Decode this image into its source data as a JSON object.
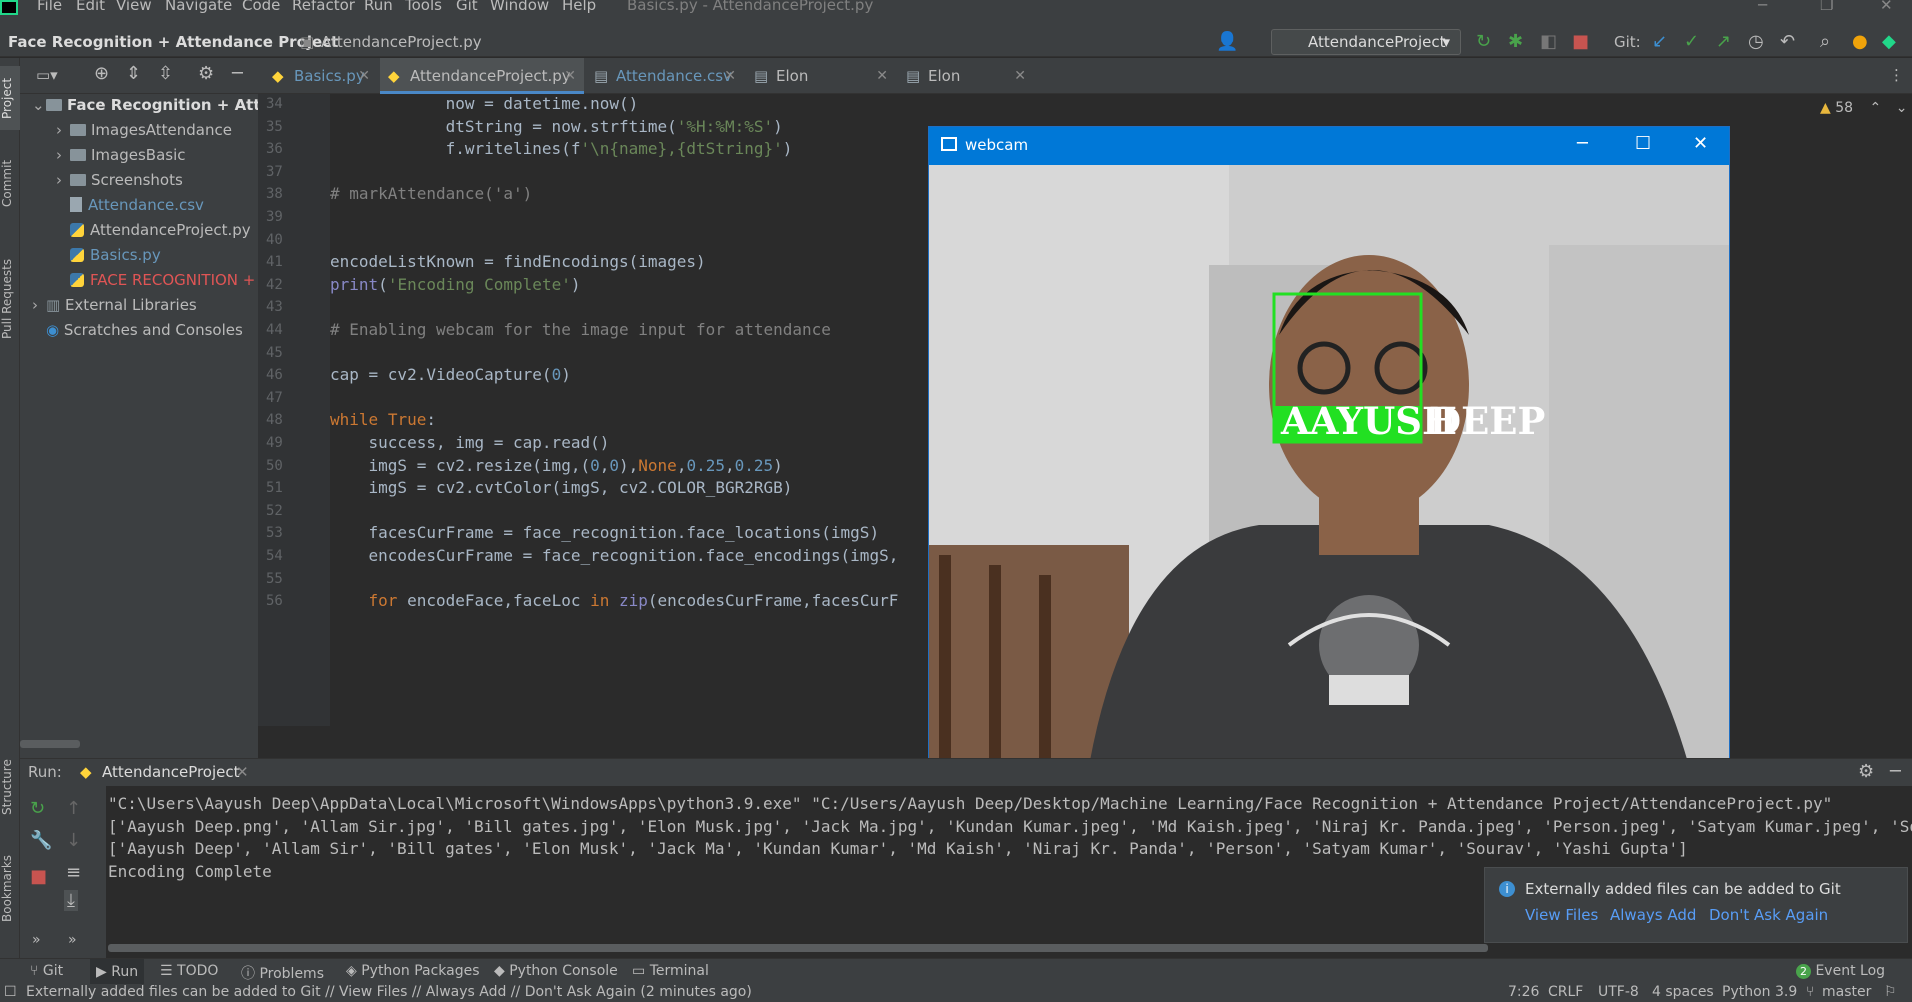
{
  "menubar": {
    "items": [
      "File",
      "Edit",
      "View",
      "Navigate",
      "Code",
      "Refactor",
      "Run",
      "Tools",
      "Git",
      "Window",
      "Help"
    ],
    "window_title": "Basics.py - AttendanceProject.py"
  },
  "navbar": {
    "project": "Face Recognition + Attendance Project",
    "file": "AttendanceProject.py",
    "run_config": "AttendanceProject",
    "git_label": "Git:"
  },
  "left_strip": {
    "project": "Project",
    "commit": "Commit",
    "pull_requests": "Pull Requests",
    "structure": "Structure",
    "bookmarks": "Bookmarks"
  },
  "project_tree": [
    {
      "label": "Face Recognition + Attenc",
      "kind": "folder",
      "level": 0,
      "expanded": true,
      "bold": true
    },
    {
      "label": "ImagesAttendance",
      "kind": "folder",
      "level": 1
    },
    {
      "label": "ImagesBasic",
      "kind": "folder",
      "level": 1
    },
    {
      "label": "Screenshots",
      "kind": "folder",
      "level": 1
    },
    {
      "label": "Attendance.csv",
      "kind": "csv",
      "level": 1,
      "color": "#6897bb"
    },
    {
      "label": "AttendanceProject.py",
      "kind": "py",
      "level": 1
    },
    {
      "label": "Basics.py",
      "kind": "py",
      "level": 1,
      "color": "#6897bb"
    },
    {
      "label": "FACE RECOGNITION + A",
      "kind": "py",
      "level": 1,
      "color": "#e05555"
    },
    {
      "label": "External Libraries",
      "kind": "lib",
      "level": 0
    },
    {
      "label": "Scratches and Consoles",
      "kind": "scratch",
      "level": 0
    }
  ],
  "editor_tabs": [
    {
      "label": "Basics.py",
      "color": "#6897bb",
      "active": false
    },
    {
      "label": "AttendanceProject.py",
      "color": "#bbbbbb",
      "active": true
    },
    {
      "label": "Attendance.csv",
      "color": "#6897bb",
      "active": false
    },
    {
      "label": "Elon Musk.jpg",
      "color": "#bbbbbb",
      "active": false
    },
    {
      "label": "Elon test.jpg",
      "color": "#bbbbbb",
      "active": false
    }
  ],
  "editor": {
    "warnings": "58",
    "line_numbers": [
      "34",
      "35",
      "36",
      "37",
      "38",
      "39",
      "40",
      "41",
      "42",
      "43",
      "44",
      "45",
      "46",
      "47",
      "48",
      "49",
      "50",
      "51",
      "52",
      "53",
      "54",
      "55",
      "56"
    ],
    "lines": [
      "            now = datetime.now()",
      "            dtString = now.strftime('%H:%M:%S')",
      "            f.writelines(f'\\n{name},{dtString}')",
      "",
      "# markAttendance('a')",
      "",
      "",
      "encodeListKnown = findEncodings(images)",
      "print('Encoding Complete')",
      "",
      "# Enabling webcam for the image input for attendance",
      "",
      "cap = cv2.VideoCapture(0)",
      "",
      "while True:",
      "    success, img = cap.read()",
      "    imgS = cv2.resize(img,(0,0),None,0.25,0.25)",
      "    imgS = cv2.cvtColor(imgS, cv2.COLOR_BGR2RGB)",
      "",
      "    facesCurFrame = face_recognition.face_locations(imgS)",
      "    encodesCurFrame = face_recognition.face_encodings(imgS,",
      "",
      "    for encodeFace,faceLoc in zip(encodesCurFrame,facesCurF"
    ]
  },
  "webcam": {
    "title": "webcam",
    "label_box": "AAYUSH",
    "label_rest": "DEEP"
  },
  "run": {
    "label": "Run:",
    "tab": "AttendanceProject",
    "console": [
      "\"C:\\Users\\Aayush Deep\\AppData\\Local\\Microsoft\\WindowsApps\\python3.9.exe\" \"C:/Users/Aayush Deep/Desktop/Machine Learning/Face Recognition + Attendance Project/AttendanceProject.py\"",
      "['Aayush Deep.png', 'Allam Sir.jpg', 'Bill gates.jpg', 'Elon Musk.jpg', 'Jack Ma.jpg', 'Kundan Kumar.jpeg', 'Md Kaish.jpeg', 'Niraj Kr. Panda.jpeg', 'Person.jpeg', 'Satyam Kumar.jpeg', 'Sourav.jpg', 'Yashi Gupta.jpg']",
      "['Aayush Deep', 'Allam Sir', 'Bill gates', 'Elon Musk', 'Jack Ma', 'Kundan Kumar', 'Md Kaish', 'Niraj Kr. Panda', 'Person', 'Satyam Kumar', 'Sourav', 'Yashi Gupta']",
      "Encoding Complete"
    ]
  },
  "notification": {
    "message": "Externally added files can be added to Git",
    "view_files": "View Files",
    "always_add": "Always Add",
    "dont_ask": "Don't Ask Again"
  },
  "bottom_tabs": [
    {
      "label": "Git",
      "icon": "git-branch-icon"
    },
    {
      "label": "Run",
      "icon": "play-icon"
    },
    {
      "label": "TODO",
      "icon": "list-icon"
    },
    {
      "label": "Problems",
      "icon": "info-icon"
    },
    {
      "label": "Python Packages",
      "icon": "layers-icon"
    },
    {
      "label": "Python Console",
      "icon": "python-icon"
    },
    {
      "label": "Terminal",
      "icon": "terminal-icon"
    }
  ],
  "event_log": {
    "label": "Event Log",
    "count": "2"
  },
  "status": {
    "message": "Externally added files can be added to Git // View Files // Always Add // Don't Ask Again (2 minutes ago)",
    "position": "7:26",
    "line_sep": "CRLF",
    "encoding": "UTF-8",
    "indent": "4 spaces",
    "interpreter": "Python 3.9",
    "branch": "master"
  },
  "colors": {
    "accent_blue": "#0078d7",
    "face_box": "#22e022",
    "link": "#589df6"
  }
}
